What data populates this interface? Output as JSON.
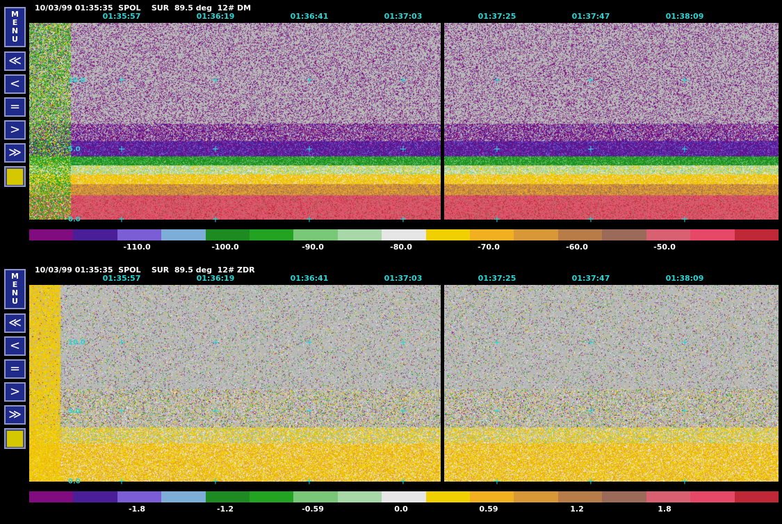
{
  "colors": {
    "background": "#000000",
    "time_text": "#28d4d4",
    "header_text": "#ffffff",
    "button_bg": "#1f2a8a",
    "button_border": "#8f96c8",
    "swatch": "#d5c800",
    "plot_bg": "#b8b8b8"
  },
  "sidebar": {
    "menu_letters": [
      "M",
      "E",
      "N",
      "U"
    ],
    "buttons": [
      {
        "name": "first",
        "glyph": "≪",
        "icon": "double-chevron-left-icon"
      },
      {
        "name": "previous",
        "glyph": "<",
        "icon": "chevron-left-icon"
      },
      {
        "name": "equal",
        "glyph": "=",
        "icon": "equals-icon"
      },
      {
        "name": "next",
        "glyph": ">",
        "icon": "chevron-right-icon"
      },
      {
        "name": "last",
        "glyph": "≫",
        "icon": "double-chevron-right-icon"
      }
    ],
    "color_swatch": "#d5c800"
  },
  "panels": [
    {
      "header": "10/03/99 01:35:35  SPOL    SUR  89.5 deg  12# DM",
      "times": [
        "01:35:57",
        "01:36:19",
        "01:36:41",
        "01:37:03",
        "01:37:25",
        "01:37:47",
        "01:38:09"
      ],
      "y_labels": [
        "10.0",
        "5.0",
        "0.0"
      ],
      "field": "DM",
      "colorbar": {
        "colors": [
          "#800c80",
          "#4a1e99",
          "#7b5ed6",
          "#7caed8",
          "#1e8a22",
          "#22a322",
          "#78c878",
          "#a8d8a8",
          "#e6e6e6",
          "#f0d000",
          "#f0b020",
          "#d89838",
          "#b87c48",
          "#9c6a58",
          "#d86070",
          "#e84868",
          "#c02838"
        ],
        "labels": [
          "-110.0",
          "-100.0",
          "-90.0",
          "-80.0",
          "-70.0",
          "-60.0",
          "-50.0"
        ]
      }
    },
    {
      "header": "10/03/99 01:35:35  SPOL    SUR  89.5 deg  12# ZDR",
      "times": [
        "01:35:57",
        "01:36:19",
        "01:36:41",
        "01:37:03",
        "01:37:25",
        "01:37:47",
        "01:38:09"
      ],
      "y_labels": [
        "10.0",
        "5.0",
        "0.0"
      ],
      "field": "ZDR",
      "colorbar": {
        "colors": [
          "#800c80",
          "#4a1e99",
          "#7b5ed6",
          "#7caed8",
          "#1e8a22",
          "#22a322",
          "#78c878",
          "#a8d8a8",
          "#e6e6e6",
          "#f0d000",
          "#f0b020",
          "#d89838",
          "#b87c48",
          "#9c6a58",
          "#d86070",
          "#e84868",
          "#c02838"
        ],
        "labels": [
          "-1.8",
          "-1.2",
          "-0.59",
          "0.0",
          "0.59",
          "1.2",
          "1.8"
        ]
      }
    }
  ]
}
